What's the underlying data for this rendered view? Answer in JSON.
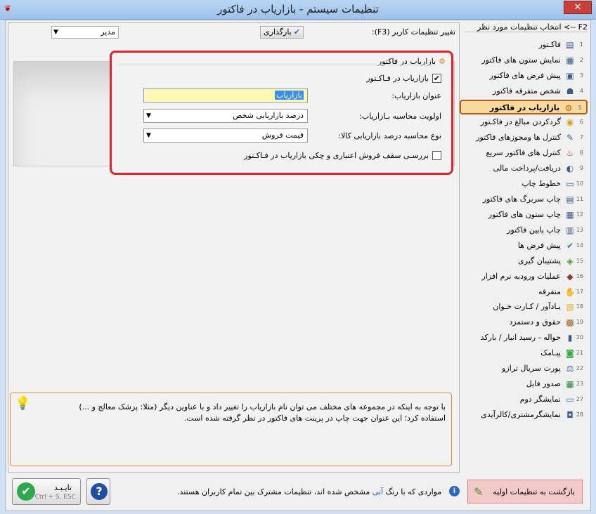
{
  "window": {
    "title": "تنظیمات سیستم - بازاریاب در فاکتور",
    "close_label": "✕"
  },
  "top": {
    "user_label": "تغییر تنظیمات کاربر (F3):",
    "user_value": "مدیر",
    "load_button": "بارگذاری"
  },
  "section": {
    "title": "بازاریاب در فاکتور",
    "enable_label": "بازاریاب در فـاکـتور",
    "enable_checked": true,
    "marketer_title_label": "عنوان بازاریاب:",
    "marketer_title_value": "بازاریاب",
    "priority_label": "اولویت محاسبه بـازاریاب:",
    "priority_value": "درصد بازاریابی شخص",
    "calc_label": "نوع محاسبه درصد بازاریابی کالا:",
    "calc_value": "قیمت فروش",
    "credit_check_label": "بررسـی سقف فروش اعتباری و چکی بازاریاب در فـاکـتور",
    "credit_check_checked": false
  },
  "hint": {
    "text": "با توجه به اینکه در مجموعه های مختلف می توان نام بازاریاب را تغییر داد و با عناوین دیگر (مثلا: پزشک معالج و ...) استفاده کرد؛ این عنوان جهت چاپ در پرینت های فاکتور در نظر گرفته شده است."
  },
  "sidebar": {
    "header": "F2 --> انتخاب تنظیمات مورد نظر",
    "items": [
      {
        "num": "1",
        "label": "فاکـتور",
        "icon": "invoice-icon"
      },
      {
        "num": "2",
        "label": "نمایش ستون های فاکتور",
        "icon": "columns-icon"
      },
      {
        "num": "3",
        "label": "پیش فرض های فاکتور",
        "icon": "defaults-icon"
      },
      {
        "num": "4",
        "label": "شخص متفرقه فاکتور",
        "icon": "person-icon"
      },
      {
        "num": "5",
        "label": "بازاریاب در فاکتور",
        "icon": "marketer-icon"
      },
      {
        "num": "6",
        "label": "گردکردن مبالغ در فاکـتور",
        "icon": "coins-icon"
      },
      {
        "num": "7",
        "label": "کنترل ها ومجوزهای فاکتور",
        "icon": "edit-icon"
      },
      {
        "num": "8",
        "label": "کنترل های فاکتور سریع",
        "icon": "basket-icon"
      },
      {
        "num": "9",
        "label": "دریافت/پرداخت مالی",
        "icon": "hand-money-icon"
      },
      {
        "num": "10",
        "label": "خطوط چاپ",
        "icon": "printer-icon"
      },
      {
        "num": "11",
        "label": "چاپ سربرگ های فاکتور",
        "icon": "header-icon"
      },
      {
        "num": "12",
        "label": "چاپ ستون های فاکتور",
        "icon": "columns-icon"
      },
      {
        "num": "13",
        "label": "چاپ پایین فاکتور",
        "icon": "footer-icon"
      },
      {
        "num": "14",
        "label": "پیش فرض ها",
        "icon": "check-icon"
      },
      {
        "num": "15",
        "label": "پشتیبان گیری",
        "icon": "backup-icon"
      },
      {
        "num": "16",
        "label": "عملیات ورودبه نرم افزار",
        "icon": "login-icon"
      },
      {
        "num": "17",
        "label": "متفرقه",
        "icon": "misc-icon"
      },
      {
        "num": "18",
        "label": "یـادآور / کـارت خـوان",
        "icon": "notes-icon"
      },
      {
        "num": "19",
        "label": "حقوق و دستمزد",
        "icon": "payroll-icon"
      },
      {
        "num": "20",
        "label": "حواله - رسید انبار / بارکد",
        "icon": "barcode-icon"
      },
      {
        "num": "21",
        "label": "پیـامک",
        "icon": "sms-icon"
      },
      {
        "num": "22",
        "label": "پورت سریال ترازو",
        "icon": "scale-icon"
      },
      {
        "num": "23",
        "label": "صدور فایل",
        "icon": "excel-icon"
      },
      {
        "num": "27",
        "label": "نمایشگر دوم",
        "icon": "monitor-icon"
      },
      {
        "num": "28",
        "label": "نمایشگرمشتری/کالرآیدی",
        "icon": "caller-id-icon"
      }
    ]
  },
  "bottom": {
    "ok_label": "تایـیـد",
    "ok_shortcut": "Ctrl + S, ESC",
    "note_before": "مواردی که با رنگ",
    "note_blue": "آبی",
    "note_after": "مشخص شده اند، تنظیمات مشترک بین تمام کاربران هستند.",
    "reset_label": "بازگشت به تنظیمات اولیه"
  }
}
